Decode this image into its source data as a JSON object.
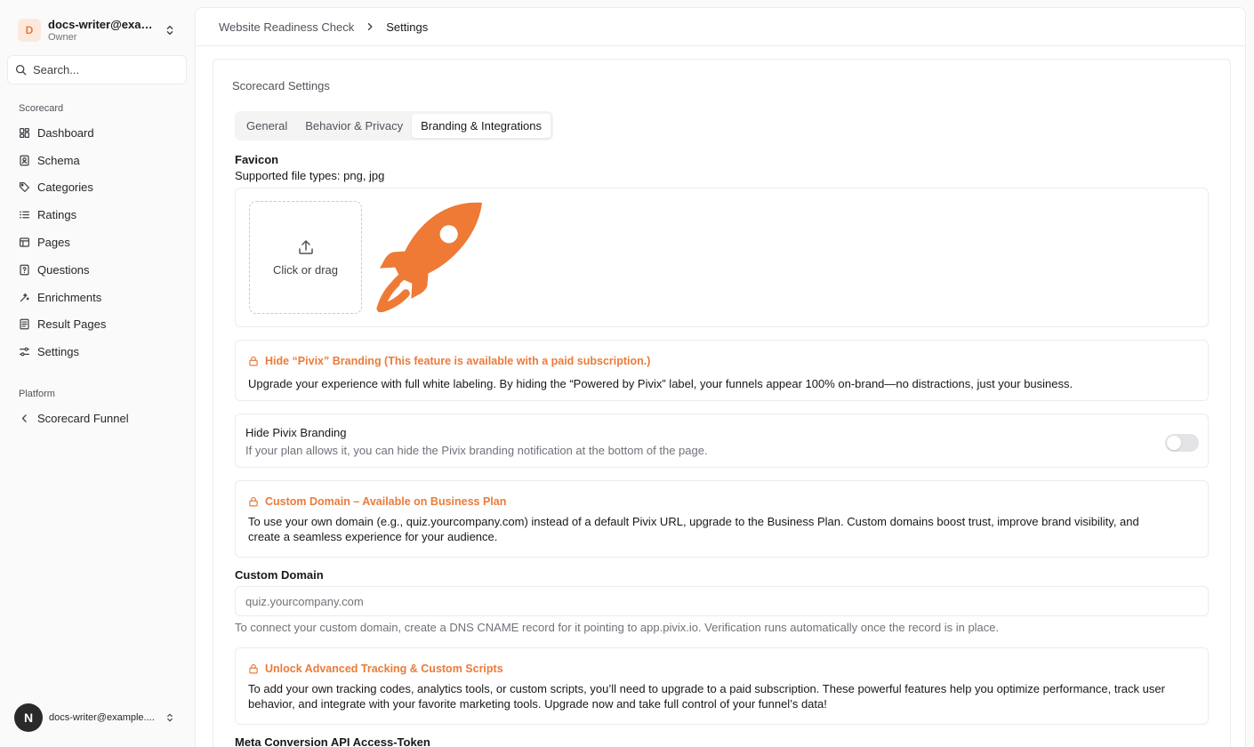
{
  "account": {
    "initial": "D",
    "name": "docs-writer@exam...",
    "role": "Owner"
  },
  "search": {
    "placeholder": "Search..."
  },
  "sidebar": {
    "group1_label": "Scorecard",
    "items": [
      {
        "label": "Dashboard",
        "icon": "dashboard-icon"
      },
      {
        "label": "Schema",
        "icon": "schema-icon"
      },
      {
        "label": "Categories",
        "icon": "tag-icon"
      },
      {
        "label": "Ratings",
        "icon": "list-icon"
      },
      {
        "label": "Pages",
        "icon": "pages-icon"
      },
      {
        "label": "Questions",
        "icon": "question-icon"
      },
      {
        "label": "Enrichments",
        "icon": "enrichment-icon"
      },
      {
        "label": "Result Pages",
        "icon": "result-icon"
      },
      {
        "label": "Settings",
        "icon": "settings-icon"
      }
    ],
    "group2_label": "Platform",
    "platform_item": {
      "label": "Scorecard Funnel",
      "icon": "chevron-left-icon"
    }
  },
  "user": {
    "initial": "N",
    "email": "docs-writer@example...."
  },
  "breadcrumb": {
    "parent": "Website Readiness Check",
    "current": "Settings"
  },
  "card": {
    "title": "Scorecard Settings",
    "tabs": [
      "General",
      "Behavior & Privacy",
      "Branding & Integrations"
    ],
    "active_tab": "Branding & Integrations"
  },
  "favicon": {
    "label": "Favicon",
    "supported": "Supported file types: png, jpg",
    "upload_label": "Click or drag"
  },
  "notice_branding": {
    "title": "Hide “Pivix” Branding (This feature is available with a paid subscription.)",
    "body": "Upgrade your experience with full white labeling. By hiding the “Powered by Pivix” label, your funnels appear 100% on-brand—no distractions, just your business."
  },
  "toggle_branding": {
    "title": "Hide Pivix Branding",
    "description": "If your plan allows it, you can hide the Pivix branding notification at the bottom of the page."
  },
  "notice_domain": {
    "title": "Custom Domain – Available on Business Plan",
    "body": "To use your own domain (e.g., quiz.yourcompany.com) instead of a default Pivix URL, upgrade to the Business Plan. Custom domains boost trust, improve brand visibility, and create a seamless experience for your audience."
  },
  "custom_domain": {
    "label": "Custom Domain",
    "placeholder": "quiz.yourcompany.com",
    "hint": "To connect your custom domain, create a DNS CNAME record for it pointing to app.pivix.io. Verification runs automatically once the record is in place."
  },
  "notice_tracking": {
    "title": "Unlock Advanced Tracking & Custom Scripts",
    "body": "To add your own tracking codes, analytics tools, or custom scripts, you’ll need to upgrade to a paid subscription. These powerful features help you optimize performance, track user behavior, and integrate with your favorite marketing tools. Upgrade now and take full control of your funnel’s data!"
  },
  "meta": {
    "label": "Meta Conversion API Access-Token"
  },
  "colors": {
    "accent": "#ea7b3a",
    "favicon": "#ee7a36"
  }
}
